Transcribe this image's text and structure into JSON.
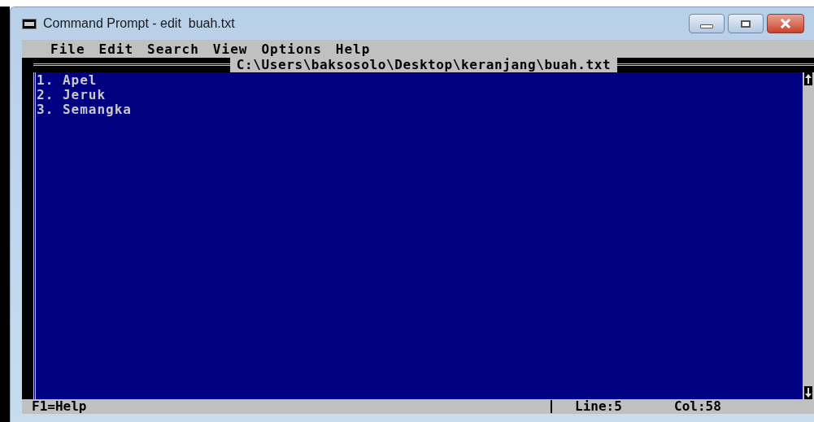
{
  "window": {
    "title": "Command Prompt - edit  buah.txt"
  },
  "menu": [
    "File",
    "Edit",
    "Search",
    "View",
    "Options",
    "Help"
  ],
  "editor": {
    "file_path": "C:\\Users\\baksosolo\\Desktop\\keranjang\\buah.txt",
    "lines": [
      "1. Apel",
      "2. Jeruk",
      "3. Semangka"
    ]
  },
  "status_bar": {
    "help": "F1=Help",
    "line": "Line:5",
    "col": "Col:58"
  }
}
